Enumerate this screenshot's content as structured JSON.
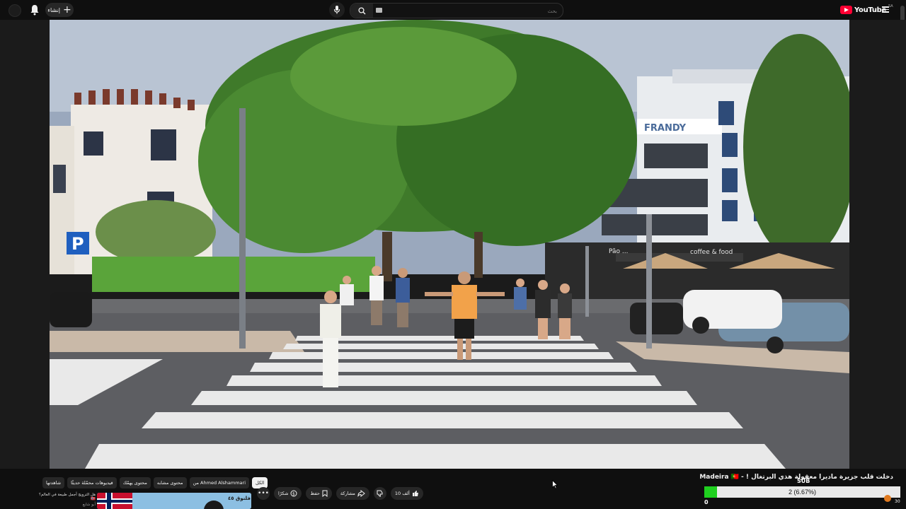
{
  "topbar": {
    "create_label": "إنشاء",
    "search_placeholder": "بحث",
    "logo_text": "YouTube",
    "logo_region": "SA"
  },
  "video": {
    "title": "دخلت قلب جزيرة ماديرا معقولة هذي البرتغال ! - Madeira 🇵🇹",
    "hotel_sign": "FRANDY",
    "sign_parking": "P",
    "shop_sign": "coffee & food",
    "restaurant_sign": "Pão ..."
  },
  "chips": [
    {
      "label": "الكل",
      "active": true
    },
    {
      "label": "من Ahmed Alshammari",
      "active": false
    },
    {
      "label": "محتوى مشابه",
      "active": false
    },
    {
      "label": "محتوى يهمّك",
      "active": false
    },
    {
      "label": "فيديوهات محمّلة حديثًا",
      "active": false
    },
    {
      "label": "شاهدتها",
      "active": false
    }
  ],
  "actions": {
    "likes": "10 ألف",
    "share": "مشاركة",
    "save": "حفظ",
    "thanks": "شكرًا"
  },
  "recommended": {
    "title": "هل الترويج أجمل طبيعة في العالم؟ 🇳🇴",
    "channel": "أبو شايع",
    "thumb_text": "فلنوق ٤٥"
  },
  "overlay": {
    "sub_label": "SUB",
    "progress_text": "2 (6.67%)",
    "progress_fraction": 0.0667,
    "min": "0",
    "max": "30"
  },
  "colors": {
    "accent": "#ff0033",
    "progress": "#1fd01f"
  }
}
